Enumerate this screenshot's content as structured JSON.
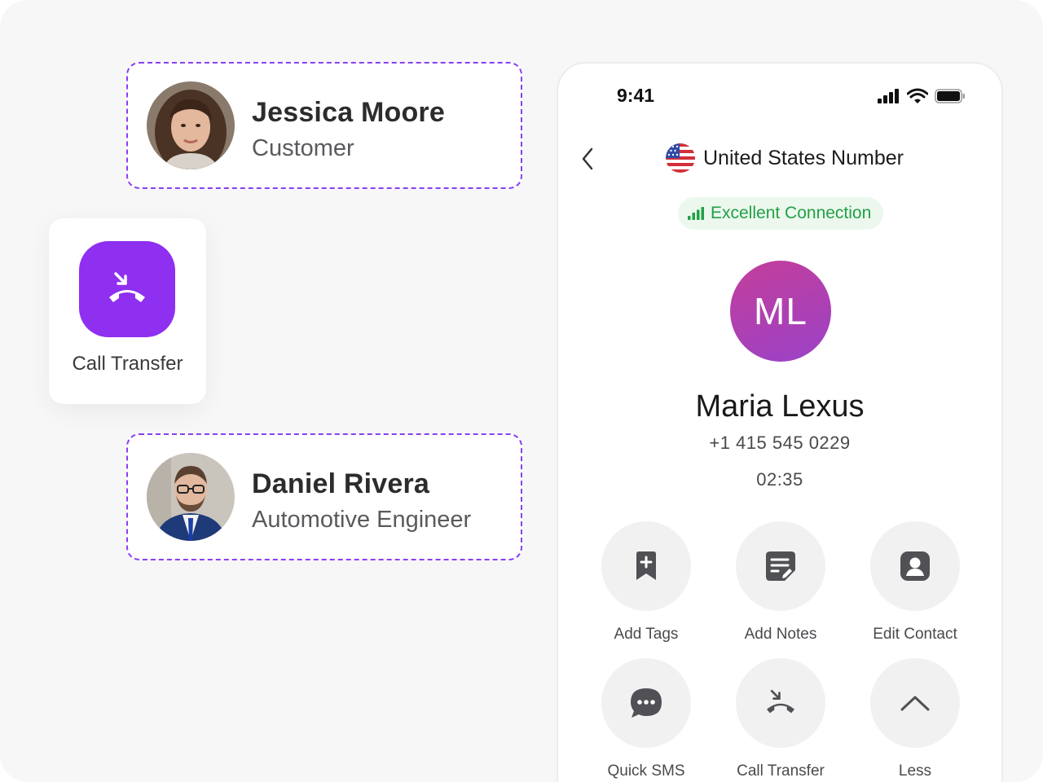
{
  "contacts": [
    {
      "name": "Jessica Moore",
      "role": "Customer",
      "avatar_icon": "woman-photo-avatar"
    },
    {
      "name": "Daniel Rivera",
      "role": "Automotive Engineer",
      "avatar_icon": "man-photo-avatar"
    }
  ],
  "transfer_card": {
    "label": "Call Transfer",
    "icon": "call-transfer-icon",
    "color": "#8f2ff0"
  },
  "status_bar": {
    "time": "9:41"
  },
  "header": {
    "title": "United States Number",
    "flag_icon": "us-flag-icon"
  },
  "connection": {
    "label": "Excellent Connection",
    "color": "#22a045"
  },
  "caller": {
    "initials": "ML",
    "name": "Maria Lexus",
    "number": "+1 415 545 0229",
    "duration": "02:35"
  },
  "actions": [
    {
      "label": "Add Tags",
      "icon": "add-tag-icon"
    },
    {
      "label": "Add Notes",
      "icon": "notes-icon"
    },
    {
      "label": "Edit Contact",
      "icon": "contact-icon"
    },
    {
      "label": "Quick SMS",
      "icon": "sms-icon"
    },
    {
      "label": "Call Transfer",
      "icon": "call-transfer-icon"
    },
    {
      "label": "Less",
      "icon": "chevron-up-icon"
    }
  ]
}
